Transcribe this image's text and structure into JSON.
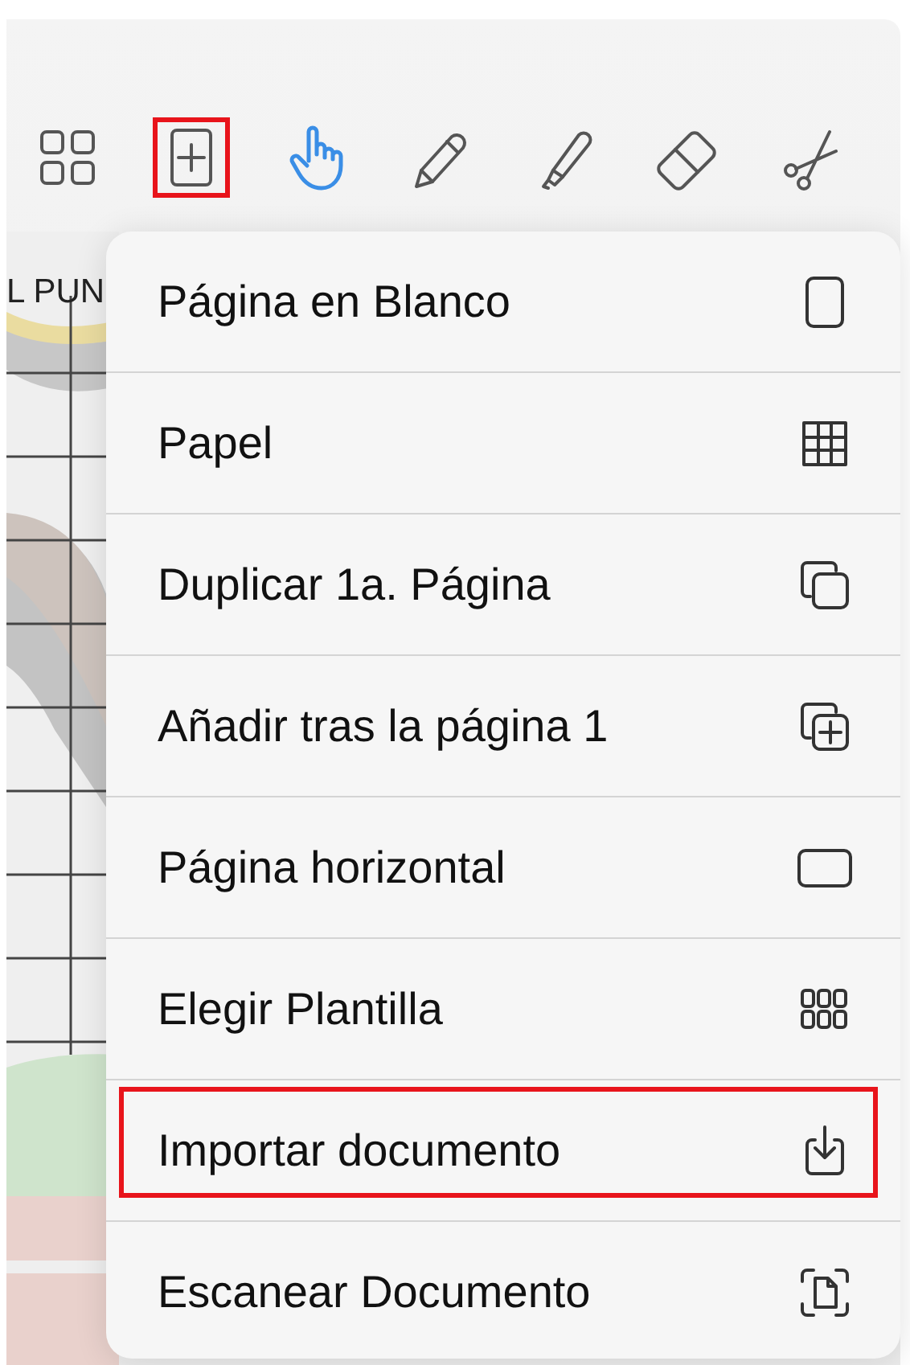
{
  "toolbar": {
    "tools": [
      {
        "kind": "pages",
        "selected": false,
        "highlighted": false
      },
      {
        "kind": "add-page",
        "selected": false,
        "highlighted": true
      },
      {
        "kind": "hand",
        "selected": true,
        "highlighted": false
      },
      {
        "kind": "pencil",
        "selected": false,
        "highlighted": false
      },
      {
        "kind": "highlighter",
        "selected": false,
        "highlighted": false
      },
      {
        "kind": "eraser",
        "selected": false,
        "highlighted": false
      },
      {
        "kind": "scissors",
        "selected": false,
        "highlighted": false
      }
    ]
  },
  "canvas": {
    "heading": "L PUN"
  },
  "menu": {
    "items": [
      {
        "label": "Página en Blanco",
        "kind": "blank",
        "highlighted": false
      },
      {
        "label": "Papel",
        "kind": "grid",
        "highlighted": false
      },
      {
        "label": "Duplicar 1a. Página",
        "kind": "duplicate",
        "highlighted": false
      },
      {
        "label": "Añadir tras la página 1",
        "kind": "add-after",
        "highlighted": false
      },
      {
        "label": "Página horizontal",
        "kind": "landscape",
        "highlighted": false
      },
      {
        "label": "Elegir Plantilla",
        "kind": "template",
        "highlighted": false
      },
      {
        "label": "Importar documento",
        "kind": "import",
        "highlighted": true
      },
      {
        "label": "Escanear Documento",
        "kind": "scan",
        "highlighted": false
      }
    ]
  }
}
